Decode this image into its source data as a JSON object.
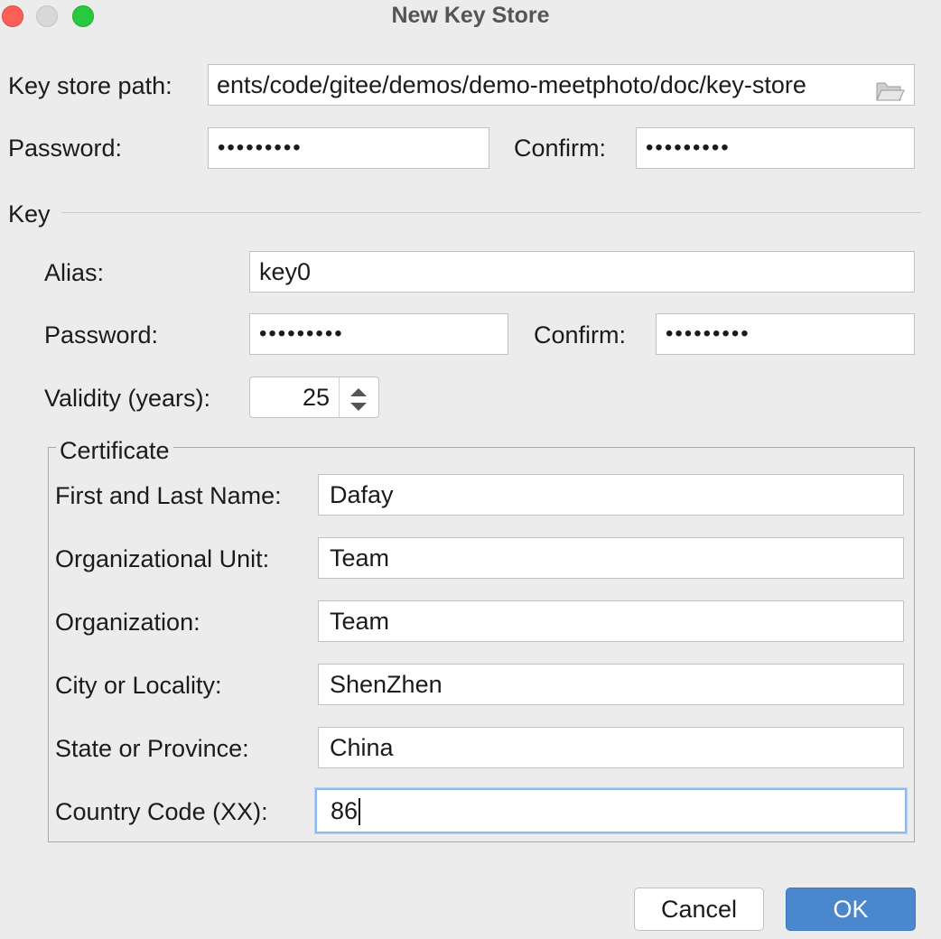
{
  "window": {
    "title": "New Key Store"
  },
  "keystore": {
    "path_label": "Key store path:",
    "path_value": "ents/code/gitee/demos/demo-meetphoto/doc/key-store",
    "password_label": "Password:",
    "password_value": "•••••••••",
    "confirm_label": "Confirm:",
    "confirm_value": "•••••••••"
  },
  "key": {
    "section_label": "Key",
    "alias_label": "Alias:",
    "alias_value": "key0",
    "password_label": "Password:",
    "password_value": "•••••••••",
    "confirm_label": "Confirm:",
    "confirm_value": "•••••••••",
    "validity_label": "Validity (years):",
    "validity_value": "25"
  },
  "certificate": {
    "group_label": "Certificate",
    "name_label": "First and Last Name:",
    "name_value": "Dafay",
    "unit_label": "Organizational Unit:",
    "unit_value": "Team",
    "org_label": "Organization:",
    "org_value": "Team",
    "city_label": "City or Locality:",
    "city_value": "ShenZhen",
    "state_label": "State or Province:",
    "state_value": "China",
    "country_label": "Country Code (XX):",
    "country_value": "86"
  },
  "buttons": {
    "cancel": "Cancel",
    "ok": "OK"
  },
  "colors": {
    "accent": "#4a87cc",
    "focus": "#8fb9eb",
    "close": "#fe5f57"
  }
}
